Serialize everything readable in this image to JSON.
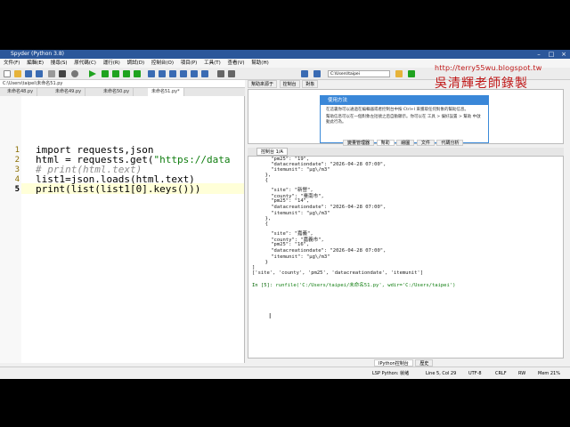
{
  "window": {
    "title": "Spyder (Python 3.8)"
  },
  "menu": [
    "文件(F)",
    "編輯(E)",
    "搜尋(S)",
    "原代碼(C)",
    "運行(R)",
    "調試(D)",
    "控制台(O)",
    "項目(P)",
    "工具(T)",
    "查看(V)",
    "幫助(H)"
  ],
  "editor": {
    "path": "C:\\Users\\taipei\\未命名51.py",
    "tabs": [
      "未命名48.py",
      "未命名49.py",
      "未命名50.py",
      "未命名51.py*"
    ],
    "line_numbers": [
      "1",
      "2",
      "3",
      "4",
      "5"
    ],
    "lines": {
      "l1": "import requests,json",
      "l2a": "html = requests.get(",
      "l2b": "\"https://data",
      "l3": "# print(html.text)",
      "l4": "list1=json.loads(html.text)",
      "l5": "print(list(list1[0].keys()))"
    }
  },
  "right": {
    "working_dir": "C:\\Users\\taipei",
    "help_tabs": [
      "幫助來源于",
      "控制台",
      "對象"
    ],
    "usage_title": "使用方法",
    "usage_text1": "在這裏你可以通過在編輯器或者控制台中按 Ctrl+I 來獲取任何對象的幫助信息。",
    "usage_text2": "幫助信息可以在一個對象左括號之后自動顯示。你可以在 工具 > 偏好設置 > 幫助 中啟動此行為。",
    "inspector_tabs": [
      "變量管理器",
      "幫助",
      "繪圖",
      "文件",
      "代碼分析"
    ],
    "console_tab": "控制台 1/A",
    "bottom_tabs": [
      "IPython控制台",
      "歷史"
    ]
  },
  "console": {
    "lines": [
      "    \"pm25\": \"19\",",
      "    \"datacreationdate\": \"2026-04-28 07:00\",",
      "    \"itemunit\": \"μg\\/m3\"",
      "  },",
      "  {",
      "    \"site\": \"新營\",",
      "    \"county\": \"臺南市\",",
      "    \"pm25\": \"14\",",
      "    \"datacreationdate\": \"2026-04-28 07:00\",",
      "    \"itemunit\": \"μg\\/m3\"",
      "  },",
      "  {",
      "    \"site\": \"嘉義\",",
      "    \"county\": \"嘉義市\",",
      "    \"pm25\": \"16\",",
      "    \"datacreationdate\": \"2026-04-28 07:00\",",
      "    \"itemunit\": \"μg\\/m3\"",
      "  }",
      "]",
      "['site', 'county', 'pm25', 'datacreationdate', 'itemunit']"
    ],
    "prompt": "In [5]:",
    "command": "runfile('C:/Users/taipei/未命名51.py', wdir='C:/Users/taipei')"
  },
  "status": {
    "env": "LSP Python: 就绪",
    "position": "Line 5, Col 29",
    "encoding": "UTF-8",
    "eol": "CRLF",
    "rw": "RW",
    "mem": "Mem 21%"
  },
  "watermark": {
    "url": "http://terry55wu.blogspot.tw",
    "sign": "吳清輝老師錄製"
  }
}
